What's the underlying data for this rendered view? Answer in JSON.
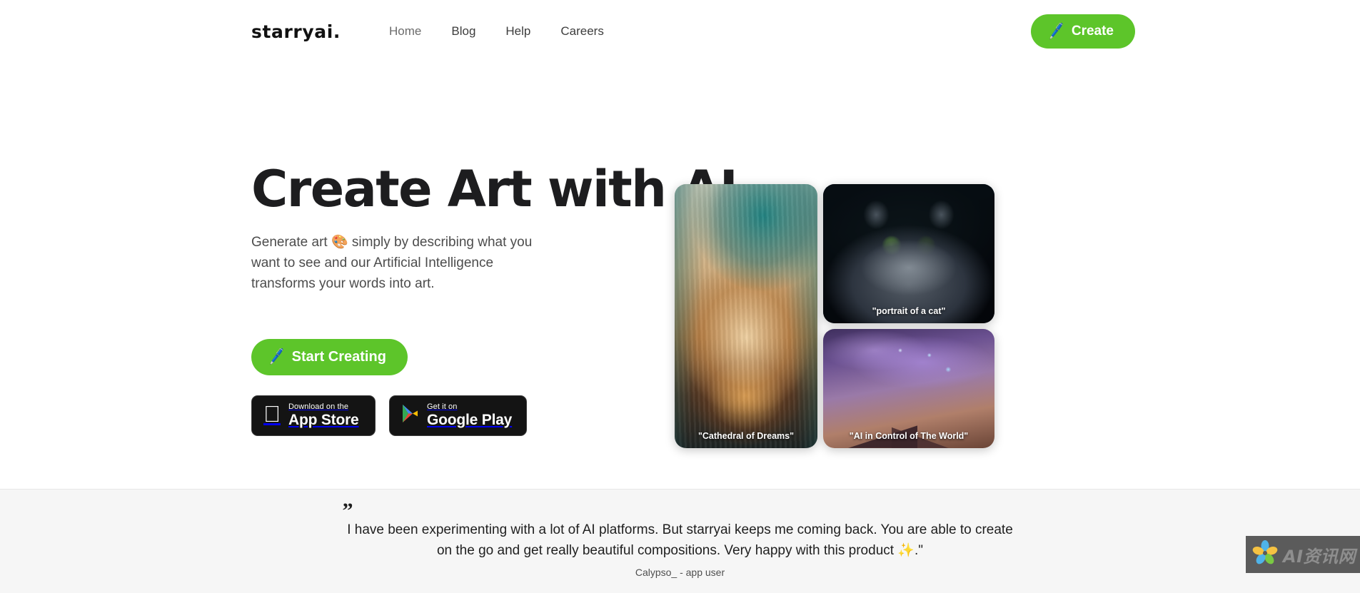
{
  "header": {
    "brand": "starryai",
    "brand_dot": ".",
    "nav": [
      {
        "label": "Home",
        "active": true
      },
      {
        "label": "Blog",
        "active": false
      },
      {
        "label": "Help",
        "active": false
      },
      {
        "label": "Careers",
        "active": false
      }
    ],
    "create_button": {
      "label": "Create",
      "icon": "pencil-icon",
      "emoji": "🖊️"
    }
  },
  "hero": {
    "title": "Create Art with AI",
    "subtitle": "Generate art 🎨 simply by describing what you want to see and our Artificial Intelligence transforms your words into art.",
    "start_button": {
      "label": "Start Creating",
      "icon": "pencil-icon",
      "emoji": "🖊️"
    },
    "badges": [
      {
        "small": "Download on the",
        "large": "App Store",
        "icon": "apple-icon",
        "glyph": ""
      },
      {
        "small": "Get it on",
        "large": "Google Play",
        "icon": "google-play-icon"
      }
    ],
    "gallery": [
      {
        "caption": "\"Cathedral of Dreams\"",
        "name": "cathedral"
      },
      {
        "caption": "\"portrait of a cat\"",
        "name": "cat"
      },
      {
        "caption": "\"AI in Control of The World\"",
        "name": "cosmic"
      }
    ]
  },
  "testimonial": {
    "quote_mark": "”",
    "text": "I have been experimenting with a lot of AI platforms. But starryai keeps me coming back. You are able to create on the go and get really beautiful compositions. Very happy with this product ✨.\"",
    "author": "Calypso_ - app user"
  },
  "watermark": {
    "text": "AI资讯网",
    "icon": "flower-logo-icon"
  },
  "colors": {
    "accent_green": "#5dc52a",
    "page_bg": "#ffffff",
    "testimonial_bg": "#f6f6f6",
    "badge_bg": "#141414",
    "text_primary": "#1d1d1f",
    "text_secondary": "#4c4c4c"
  }
}
